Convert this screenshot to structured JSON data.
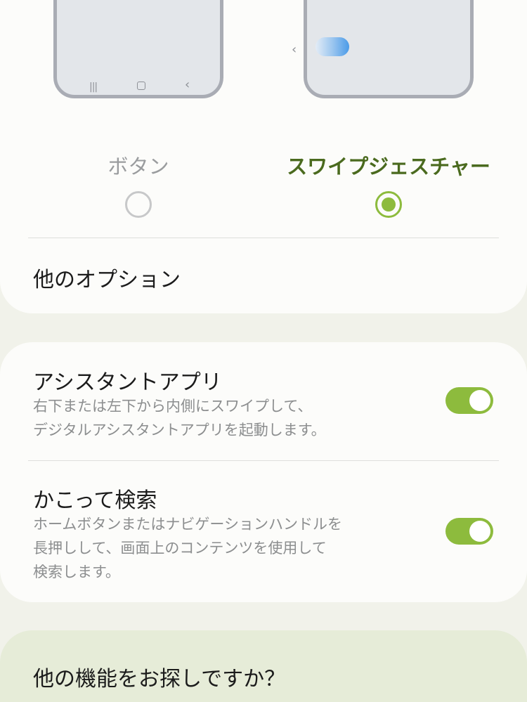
{
  "navigation_type": {
    "options": [
      {
        "label": "ボタン",
        "selected": false,
        "nav_icons": [
          "recents-icon",
          "home-icon",
          "back-icon"
        ]
      },
      {
        "label": "スワイプジェスチャー",
        "selected": true,
        "nav_icons": [
          "back-chevron-icon",
          "gesture-handle-icon"
        ]
      }
    ],
    "nav_glyphs": {
      "recents": "|||",
      "back": "‹"
    },
    "more_options_label": "他のオプション"
  },
  "settings": {
    "assistant_app": {
      "title": "アシスタントアプリ",
      "description_line1": "右下または左下から内側にスワイプして、",
      "description_line2": "デジタルアシスタントアプリを起動します。",
      "enabled": true
    },
    "circle_to_search": {
      "title": "かこって検索",
      "description_line1": "ホームボタンまたはナビゲーションハンドルを",
      "description_line2": "長押しして、画面上のコンテンツを使用して",
      "description_line3": "検索します。",
      "enabled": true
    }
  },
  "suggestion": {
    "title": "他の機能をお探しですか？"
  },
  "colors": {
    "accent": "#8dbb3d",
    "selected_label": "#4a6a1e",
    "card": "#fcfcfa",
    "background": "#f1f2ea",
    "suggestion_card": "#e6ecd8"
  }
}
